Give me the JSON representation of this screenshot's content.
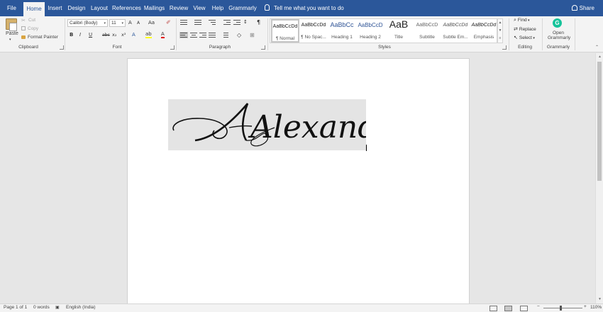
{
  "tabs": [
    "File",
    "Home",
    "Insert",
    "Design",
    "Layout",
    "References",
    "Mailings",
    "Review",
    "View",
    "Help",
    "Grammarly"
  ],
  "active_tab": "Home",
  "tell_me": "Tell me what you want to do",
  "share_label": "Share",
  "clipboard": {
    "paste": "Paste",
    "cut": "Cut",
    "copy": "Copy",
    "format_painter": "Format Painter",
    "group_label": "Clipboard"
  },
  "font": {
    "name": "Calibri (Body)",
    "size": "11",
    "grow": "A",
    "shrink": "A",
    "change_case": "Aa",
    "bold": "B",
    "italic": "I",
    "underline": "U",
    "strike": "abc",
    "subscript": "x₂",
    "superscript": "x²",
    "font_color": "A",
    "group_label": "Font"
  },
  "paragraph": {
    "pilcrow": "¶",
    "group_label": "Paragraph"
  },
  "styles": {
    "items": [
      {
        "preview": "AaBbCcDd",
        "name": "¶ Normal"
      },
      {
        "preview": "AaBbCcDd",
        "name": "¶ No Spac..."
      },
      {
        "preview": "AaBbCc",
        "name": "Heading 1"
      },
      {
        "preview": "AaBbCcD",
        "name": "Heading 2"
      },
      {
        "preview": "AaB",
        "name": "Title"
      },
      {
        "preview": "AaBbCcD",
        "name": "Subtitle"
      },
      {
        "preview": "AaBbCcDd",
        "name": "Subtle Em..."
      },
      {
        "preview": "AaBbCcDd",
        "name": "Emphasis"
      }
    ],
    "group_label": "Styles"
  },
  "editing": {
    "find": "Find",
    "replace": "Replace",
    "select": "Select",
    "group_label": "Editing"
  },
  "grammarly": {
    "open_line1": "Open",
    "open_line2": "Grammarly",
    "group_label": "Grammarly"
  },
  "document": {
    "signature_text": "Alexander"
  },
  "status": {
    "page": "Page 1 of 1",
    "words": "0 words",
    "language": "English (India)",
    "zoom": "110%",
    "zoom_minus": "−",
    "zoom_plus": "+"
  },
  "colors": {
    "title_bar": "#2b579a",
    "ribbon": "#f3f3f3",
    "highlight_yellow": "#ffff00",
    "font_color_red": "#e00000",
    "grammarly_green": "#15c39a"
  },
  "icons": [
    "lightbulb-icon",
    "share-person-icon",
    "clipboard-icon",
    "scissors-icon",
    "copy-icon",
    "brush-icon",
    "find-icon",
    "replace-icon",
    "select-icon",
    "grammarly-icon"
  ]
}
